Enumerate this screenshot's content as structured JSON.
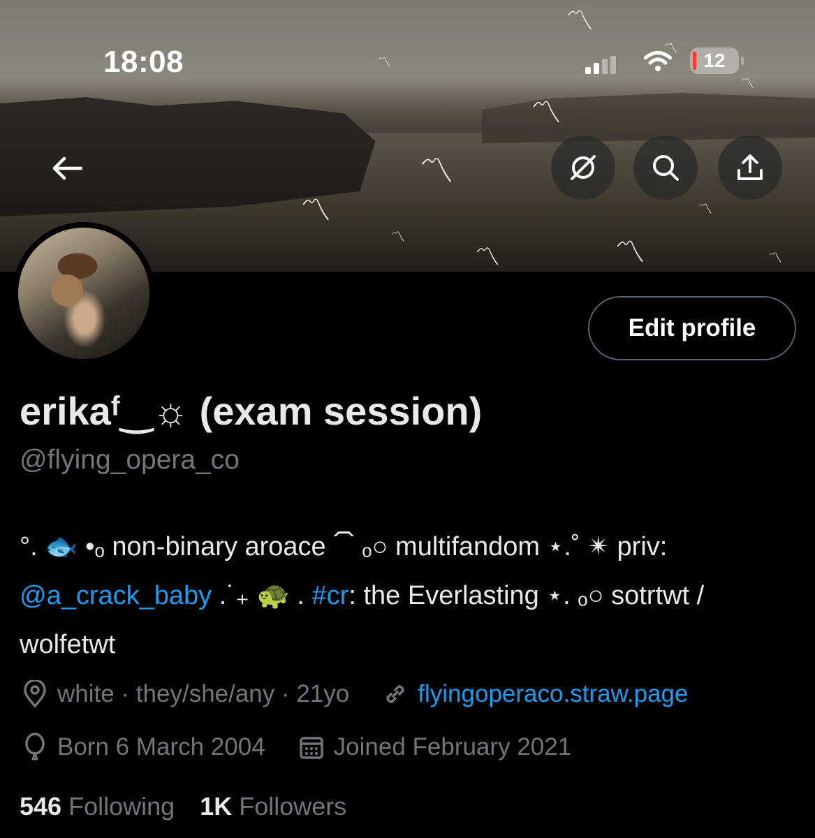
{
  "status_bar": {
    "time": "18:08",
    "battery": "12"
  },
  "profile": {
    "display_name": "erikaᶠ‿☼ (exam session)",
    "handle": "@flying_opera_co",
    "edit_label": "Edit profile"
  },
  "bio": {
    "line1": "°. 🐟 •ₒ non-binary aroace ⏠ ₒ○ multifandom ⋆.˚ ✴ priv:",
    "mention": "@a_crack_baby",
    "mid1": " .˙₊ 🐢 . ",
    "hashtag": "#cr",
    "rest": ": the Everlasting ⋆. ₒ○ sotrtwt / wolfetwt"
  },
  "meta": {
    "location": "white · they/she/any · 21yo",
    "website": "flyingoperaco.straw.page",
    "birthday": "Born 6 March 2004",
    "joined": "Joined February 2021"
  },
  "stats": {
    "following_count": "546",
    "following_label": "Following",
    "followers_count": "1K",
    "followers_label": "Followers"
  }
}
